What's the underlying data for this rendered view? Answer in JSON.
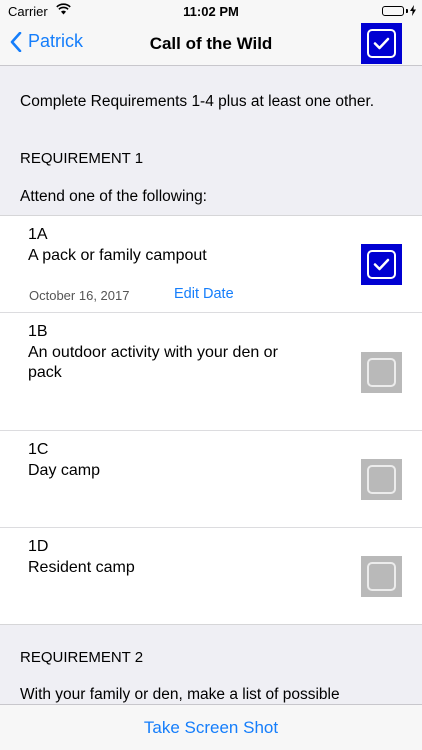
{
  "status_bar": {
    "carrier": "Carrier",
    "time": "11:02 PM"
  },
  "nav": {
    "back_label": "Patrick",
    "title": "Call of the Wild"
  },
  "intro": "Complete Requirements 1-4 plus at least one other.",
  "requirement1": {
    "heading": "REQUIREMENT 1",
    "subheading": "Attend one of the following:",
    "items": [
      {
        "code": "1A",
        "desc": "A pack or family campout",
        "date": "October 16, 2017",
        "edit_label": "Edit Date",
        "checked": true
      },
      {
        "code": "1B",
        "desc": "An outdoor activity with your den or pack",
        "checked": false
      },
      {
        "code": "1C",
        "desc": "Day camp",
        "checked": false
      },
      {
        "code": "1D",
        "desc": "Resident camp",
        "checked": false
      }
    ]
  },
  "requirement2": {
    "heading": "REQUIREMENT 2",
    "text": "With your family or den, make a list of possible"
  },
  "bottom_bar": {
    "action_label": "Take Screen Shot"
  },
  "colors": {
    "accent": "#157efb",
    "check_on": "#0000d2",
    "check_off": "#b9b9b9",
    "background": "#efeff4"
  }
}
